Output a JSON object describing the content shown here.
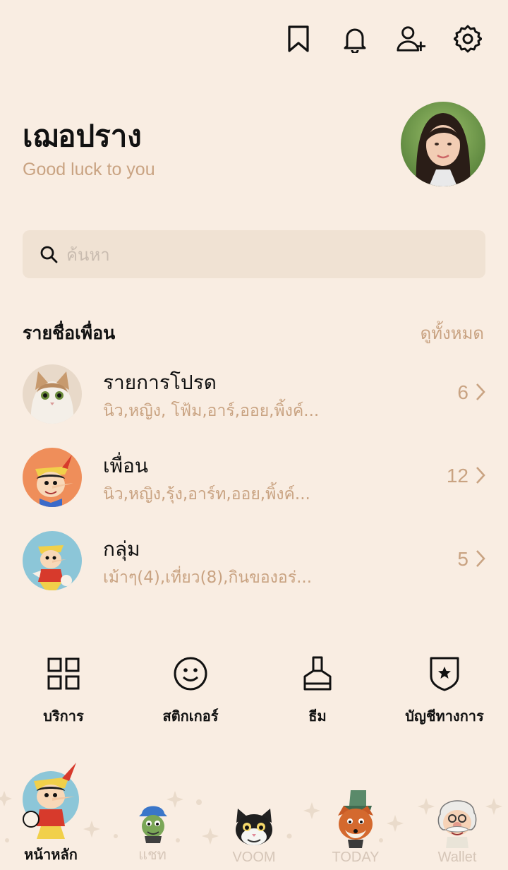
{
  "header": {
    "icons": [
      "bookmark-icon",
      "bell-icon",
      "add-friend-icon",
      "gear-icon"
    ]
  },
  "profile": {
    "name": "เฌอปราง",
    "status": "Good luck to you"
  },
  "search": {
    "placeholder": "ค้นหา"
  },
  "friends": {
    "title": "รายชื่อเพื่อน",
    "see_all": "ดูทั้งหมด",
    "rows": [
      {
        "title": "รายการโปรด",
        "subtitle": "นิว,หญิง, โฟ้ม,อาร์,ออย,พิ้งค์...",
        "count": "6"
      },
      {
        "title": "เพื่อน",
        "subtitle": "นิว,หญิง,รุ้ง,อาร์ท,ออย,พิ้งค์...",
        "count": "12"
      },
      {
        "title": "กลุ่ม",
        "subtitle": "เม้าๆ(4),เที่ยว(8),กินของอร่...",
        "count": "5"
      }
    ]
  },
  "services": [
    {
      "label": "บริการ",
      "icon": "grid-icon"
    },
    {
      "label": "สติกเกอร์",
      "icon": "smiley-icon"
    },
    {
      "label": "ธีม",
      "icon": "brush-icon"
    },
    {
      "label": "บัญชีทางการ",
      "icon": "official-badge-icon"
    }
  ],
  "bottom_nav": [
    {
      "label": "หน้าหลัก",
      "active": true
    },
    {
      "label": "แชท",
      "active": false
    },
    {
      "label": "VOOM",
      "active": false
    },
    {
      "label": "TODAY",
      "active": false
    },
    {
      "label": "Wallet",
      "active": false
    }
  ],
  "colors": {
    "background": "#f9ede2",
    "accent": "#c9a382",
    "search_bg": "#f0e2d3"
  }
}
